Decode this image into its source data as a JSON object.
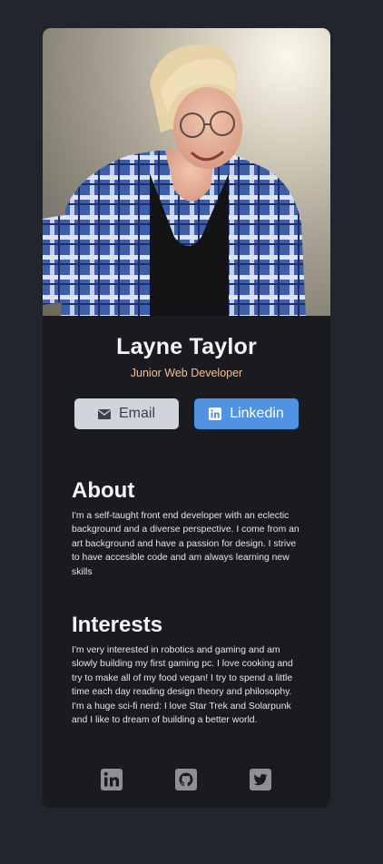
{
  "profile": {
    "name": "Layne Taylor",
    "title": "Junior Web Developer",
    "photo_icon": "portrait-photo"
  },
  "buttons": {
    "email_label": "Email",
    "email_icon": "envelope-icon",
    "linkedin_label": "Linkedin",
    "linkedin_icon": "linkedin-icon"
  },
  "about": {
    "heading": "About",
    "text": "I'm a self-taught front end developer with an eclectic background and a diverse perspective. I come from an art background and have a passion for design. I strive to have accesible code and am always learning new skills"
  },
  "interests": {
    "heading": "Interests",
    "text": "I'm very interested in robotics and gaming and am slowly building my first gaming pc. I love cooking and try to make all of my food vegan! I try to spend a little time each day reading design theory and philosophy. I'm a huge sci-fi nerd: I love Star Trek and Solarpunk and I like to dream of building a better world."
  },
  "footer": {
    "icons": [
      "linkedin-icon",
      "github-icon",
      "twitter-icon"
    ]
  },
  "colors": {
    "page_bg": "#23252c",
    "card_bg": "#1a1b20",
    "accent_title": "#f3bf99",
    "email_button_bg": "#d1d5db",
    "linkedin_button_bg": "#5093e2",
    "footer_icon": "#8f9096"
  }
}
